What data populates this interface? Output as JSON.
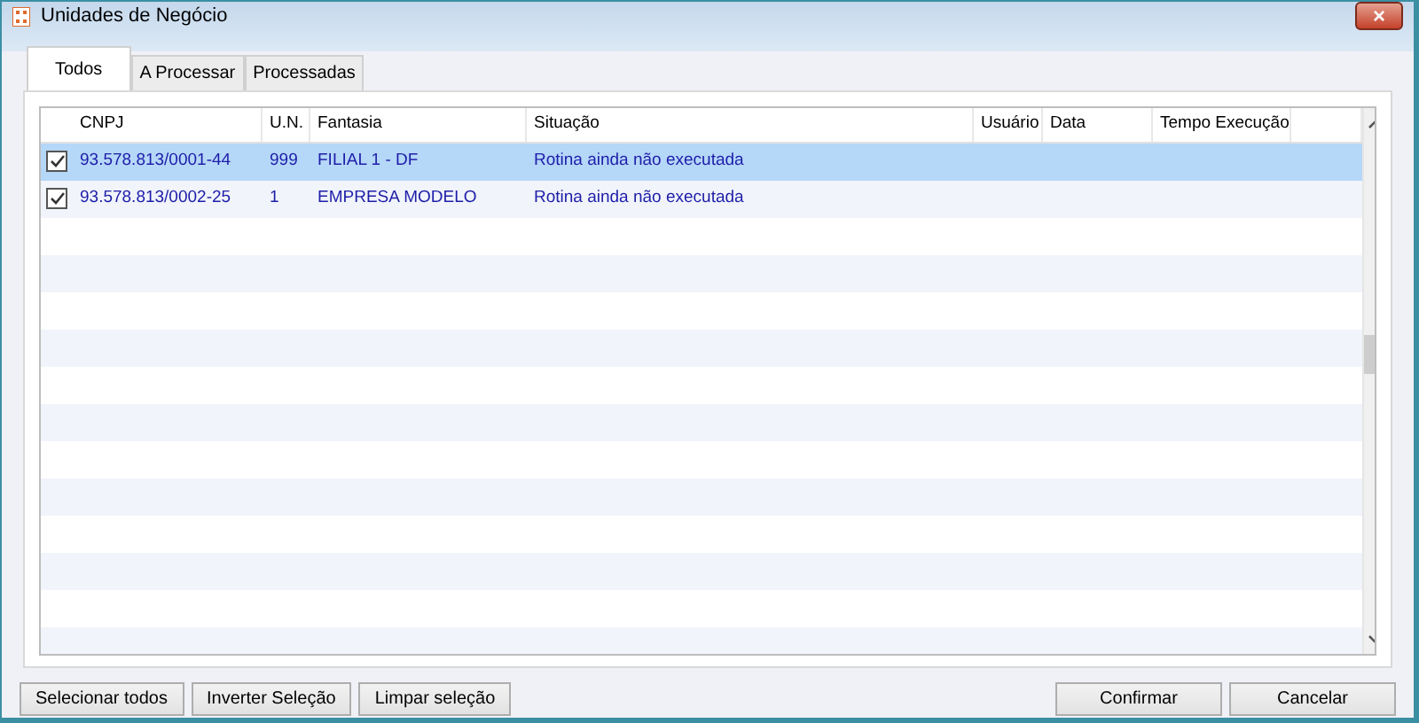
{
  "window": {
    "title": "Unidades de Negócio",
    "close": "×"
  },
  "tabs": [
    {
      "label": "Todos",
      "selected": true
    },
    {
      "label": "A Processar",
      "selected": false
    },
    {
      "label": "Processadas",
      "selected": false
    }
  ],
  "table": {
    "columns": [
      "CNPJ",
      "U.N.",
      "Fantasia",
      "Situação",
      "Usuário",
      "Data",
      "Tempo Execução"
    ],
    "rows": [
      {
        "checked": true,
        "selected": true,
        "cells": [
          "93.578.813/0001-44",
          "999",
          "FILIAL 1 - DF",
          "Rotina ainda não executada",
          "",
          "",
          ""
        ]
      },
      {
        "checked": true,
        "selected": false,
        "cells": [
          "93.578.813/0002-25",
          "1",
          "EMPRESA MODELO",
          "Rotina ainda não executada",
          "",
          "",
          ""
        ]
      }
    ]
  },
  "buttons_left": [
    "Selecionar todos",
    "Inverter Seleção",
    "Limpar seleção"
  ],
  "buttons_right": [
    "Confirmar",
    "Cancelar"
  ]
}
